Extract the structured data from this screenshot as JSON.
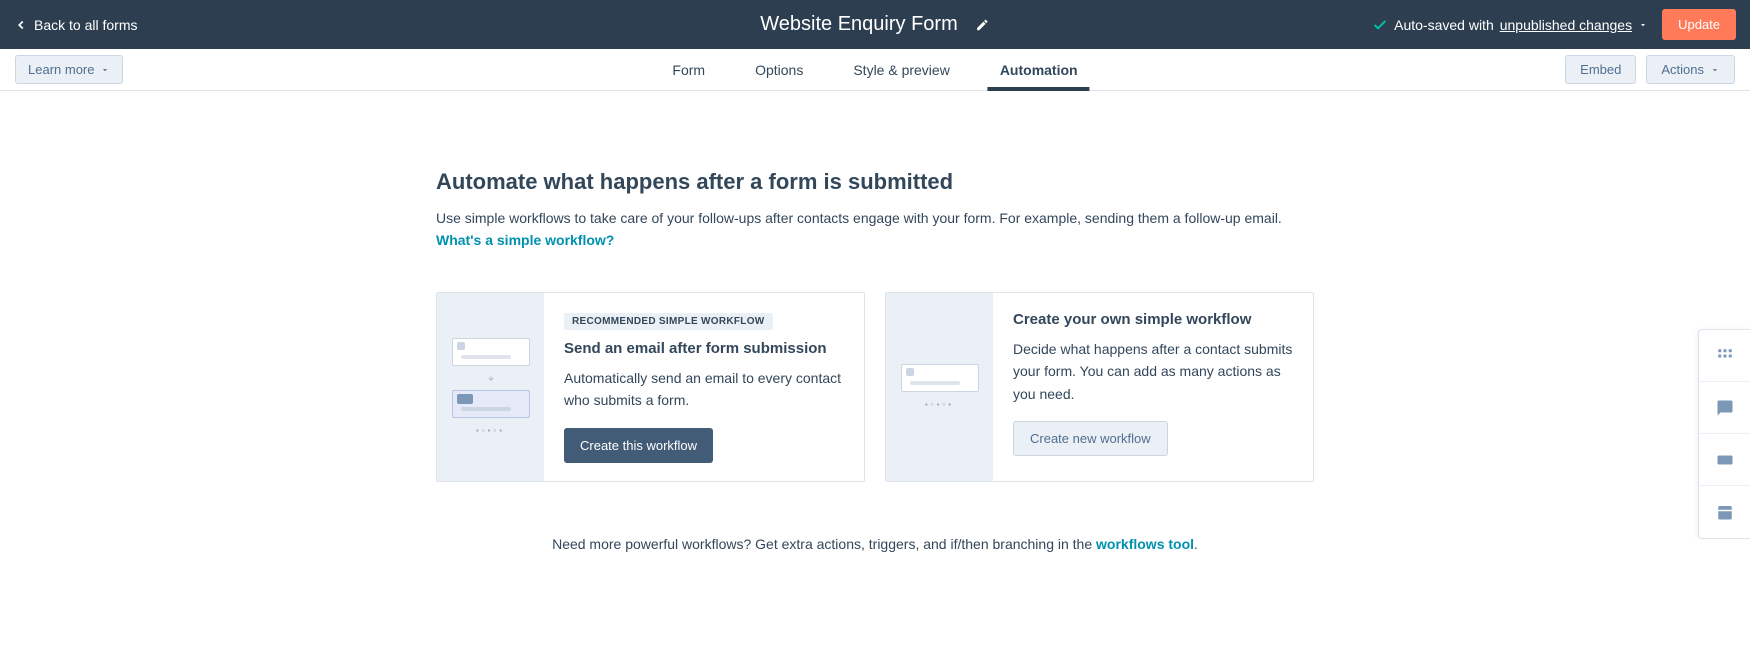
{
  "topbar": {
    "back_label": "Back to all forms",
    "form_title": "Website Enquiry Form",
    "autosave_prefix": "Auto-saved with ",
    "autosave_changes": "unpublished changes",
    "update_label": "Update"
  },
  "subbar": {
    "learn_more": "Learn more",
    "tabs": [
      "Form",
      "Options",
      "Style & preview",
      "Automation"
    ],
    "active_tab": "Automation",
    "embed": "Embed",
    "actions": "Actions"
  },
  "automation": {
    "heading": "Automate what happens after a form is submitted",
    "subtext": "Use simple workflows to take care of your follow-ups after contacts engage with your form. For example, sending them a follow-up email.  ",
    "link_text": "What's a simple workflow?",
    "cards": [
      {
        "badge": "RECOMMENDED SIMPLE WORKFLOW",
        "title": "Send an email after form submission",
        "desc": "Automatically send an email to every contact who submits a form.",
        "button": "Create this workflow",
        "primary": true
      },
      {
        "title": "Create your own simple workflow",
        "desc": "Decide what happens after a contact submits your form. You can add as many actions as you need.",
        "button": "Create new workflow",
        "primary": false
      }
    ],
    "footer_prefix": "Need more powerful workflows? Get extra actions, triggers, and if/then branching in the ",
    "footer_link": "workflows tool",
    "footer_suffix": "."
  }
}
